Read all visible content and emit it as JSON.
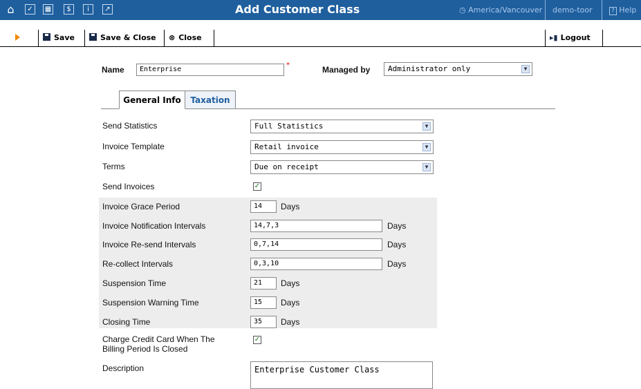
{
  "header": {
    "title": "Add Customer Class",
    "timezone": "America/Vancouver",
    "user": "demo-toor",
    "help": "Help",
    "icons": [
      "home-icon",
      "tasks-icon",
      "grid-icon",
      "billing-icon",
      "info-icon",
      "chart-icon"
    ]
  },
  "toolbar": {
    "save": "Save",
    "save_close": "Save & Close",
    "close": "Close",
    "logout": "Logout"
  },
  "form": {
    "name_label": "Name",
    "name_value": "Enterprise",
    "required_mark": "*",
    "managed_by_label": "Managed by",
    "managed_by_value": "Administrator only"
  },
  "tabs": [
    "General Info",
    "Taxation"
  ],
  "general": {
    "send_statistics": {
      "label": "Send Statistics",
      "value": "Full Statistics"
    },
    "invoice_template": {
      "label": "Invoice Template",
      "value": "Retail invoice"
    },
    "terms": {
      "label": "Terms",
      "value": "Due on receipt"
    },
    "send_invoices": {
      "label": "Send Invoices",
      "checked": true
    },
    "grace_period": {
      "label": "Invoice Grace Period",
      "value": "14",
      "unit": "Days"
    },
    "notification_intervals": {
      "label": "Invoice Notification Intervals",
      "value": "14,7,3",
      "unit": "Days"
    },
    "resend_intervals": {
      "label": "Invoice Re-send Intervals",
      "value": "0,7,14",
      "unit": "Days"
    },
    "recollect_intervals": {
      "label": "Re-collect Intervals",
      "value": "0,3,10",
      "unit": "Days"
    },
    "suspension_time": {
      "label": "Suspension Time",
      "value": "21",
      "unit": "Days"
    },
    "suspension_warning": {
      "label": "Suspension Warning Time",
      "value": "15",
      "unit": "Days"
    },
    "closing_time": {
      "label": "Closing Time",
      "value": "35",
      "unit": "Days"
    },
    "charge_cc_line1": "Charge Credit Card When The",
    "charge_cc_line2": "Billing Period Is Closed",
    "charge_cc_checked": true,
    "description": {
      "label": "Description",
      "value": "Enterprise Customer Class"
    }
  },
  "colors": {
    "header_bg": "#1f5f9e",
    "accent": "#f08a00",
    "check": "#1a7a1a"
  }
}
